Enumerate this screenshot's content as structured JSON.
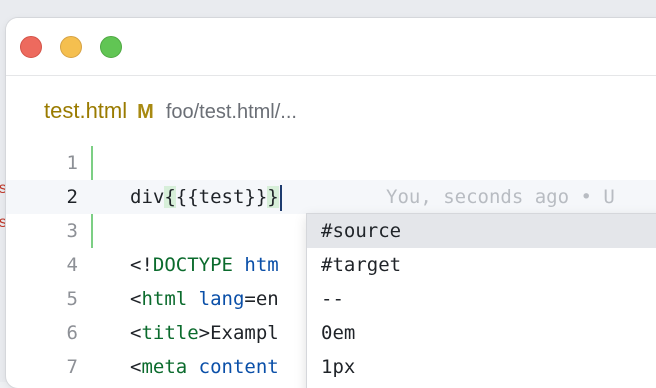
{
  "window": {
    "traffic_lights": [
      "close",
      "minimize",
      "maximize"
    ]
  },
  "background_window": {
    "marks": [
      "s",
      "s"
    ]
  },
  "breadcrumb": {
    "file_name": "test.html",
    "git_status": "M",
    "path": "foo/test.html/..."
  },
  "editor": {
    "lines": [
      {
        "number": "1",
        "text": ""
      },
      {
        "number": "2",
        "text_prefix": "div",
        "brace_open": "{",
        "text_middle": "{{test}}",
        "brace_close": "}"
      },
      {
        "number": "3",
        "text": ""
      },
      {
        "number": "4",
        "punct_open": "<!",
        "tag": "DOCTYPE",
        "rest": " htm"
      },
      {
        "number": "5",
        "punct_open": "<",
        "tag": "html",
        "attr": " lang",
        "rest": "=en"
      },
      {
        "number": "6",
        "punct_open": "<",
        "tag": "title",
        "rest": ">Exampl"
      },
      {
        "number": "7",
        "punct_open": "<",
        "tag": "meta",
        "attr": " content",
        "rest": ""
      }
    ],
    "blame": "You, seconds ago • U"
  },
  "suggestions": {
    "items": [
      "#source",
      "#target",
      "--",
      "0em",
      "1px"
    ],
    "selected_index": 0
  },
  "colors": {
    "git_modified": "#9a7b00",
    "git_added_bar": "#7ccf84",
    "tag": "#0b6b2d",
    "attr": "#0a4fa8"
  }
}
